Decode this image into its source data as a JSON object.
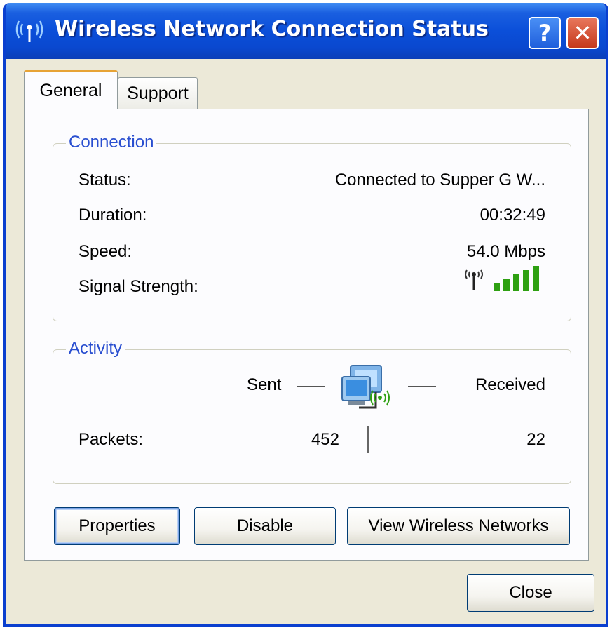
{
  "window": {
    "title": "Wireless Network Connection Status",
    "help_label": "?",
    "close_label": "✕"
  },
  "tabs": [
    {
      "label": "General",
      "active": true
    },
    {
      "label": "Support",
      "active": false
    }
  ],
  "connection": {
    "legend": "Connection",
    "status_label": "Status:",
    "status_value": "Connected to Supper G W...",
    "duration_label": "Duration:",
    "duration_value": "00:32:49",
    "speed_label": "Speed:",
    "speed_value": "54.0 Mbps",
    "signal_label": "Signal Strength:",
    "signal_bars": 5,
    "signal_level": 5,
    "signal_color": "#2ea012"
  },
  "activity": {
    "legend": "Activity",
    "sent_label": "Sent",
    "received_label": "Received",
    "packets_label": "Packets:",
    "packets_sent": "452",
    "packets_received": "22",
    "icon": "network-computers-icon"
  },
  "buttons": {
    "properties": "Properties",
    "disable": "Disable",
    "view_wireless": "View Wireless Networks",
    "close": "Close"
  },
  "colors": {
    "titlebar": "#0b4fd9",
    "legend_text": "#2a4fd0",
    "tab_highlight": "#e7a335"
  }
}
